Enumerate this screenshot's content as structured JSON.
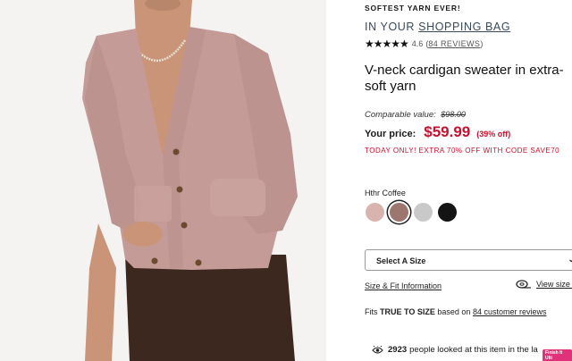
{
  "product": {
    "tagline": "SOFTEST YARN EVER!",
    "bag_prefix": "IN YOUR",
    "bag_link": "SHOPPING BAG",
    "rating_stars": "★★★★★",
    "rating_value": "4.6",
    "reviews_link": "84 REVIEWS",
    "title": "V-neck cardigan sweater in extra-soft yarn",
    "compare_label": "Comparable value:",
    "compare_price": "$98.00",
    "price_label": "Your price:",
    "price": "$59.99",
    "discount": "(39% off)",
    "promo": "TODAY ONLY! EXTRA 70% OFF WITH CODE SAVE70",
    "color_name": "Hthr Coffee",
    "swatches": [
      {
        "name": "light-pink",
        "color": "#d9b3ad",
        "selected": false
      },
      {
        "name": "heather-coffee",
        "color": "#9c7770",
        "selected": true
      },
      {
        "name": "light-gray",
        "color": "#c9c9c9",
        "selected": false
      },
      {
        "name": "black",
        "color": "#141414",
        "selected": false
      }
    ],
    "size_select": "Select A Size",
    "fit_link": "Size & Fit Information",
    "view_size_chart": "View size ch",
    "fit_prefix": "Fits",
    "fit_value": "TRUE TO SIZE",
    "fit_middle": "based on",
    "fit_reviews_link": "84 customer reviews",
    "viewers_count": "2923",
    "viewers_text": "people looked at this item in the la",
    "badge_text": "Finish It Ulti"
  },
  "colors": {
    "sale_red": "#c8102e",
    "sweater": "#c59b97",
    "skirt": "#3d2820"
  }
}
